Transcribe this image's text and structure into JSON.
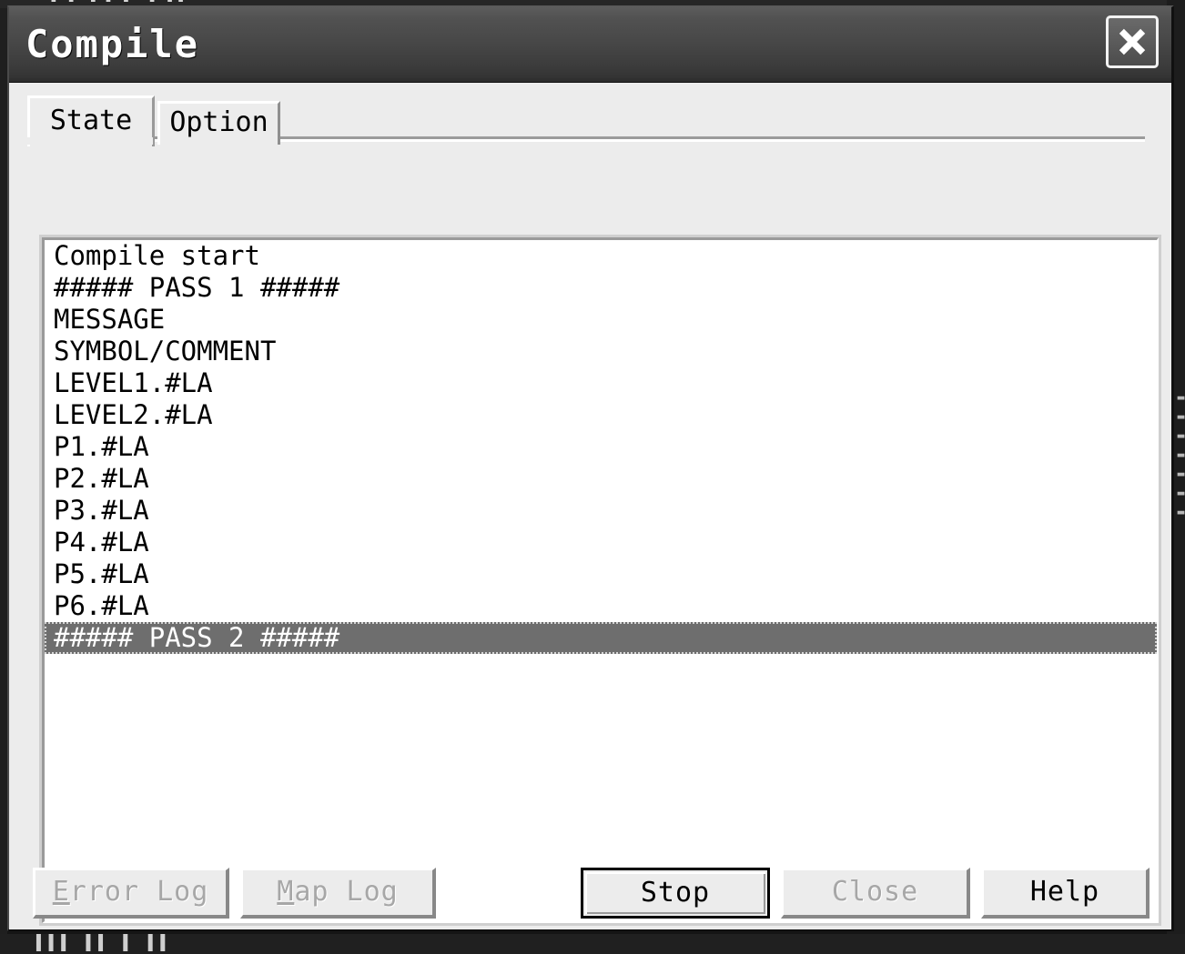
{
  "background": {
    "top_glyphs": "▐ ▌ ▌▐ ▌ ▐ ▌▌",
    "bottom_glyphs": "▌▌▌ ▌▌  ▌  ▌▌",
    "right_glyphs": "▬▬▬▬▬▬▬"
  },
  "window": {
    "title": "Compile",
    "close_icon": "close-x-icon"
  },
  "tabs": [
    {
      "label": "State",
      "active": true
    },
    {
      "label": "Option",
      "active": false
    }
  ],
  "log": {
    "lines": [
      {
        "text": "Compile start",
        "selected": false
      },
      {
        "text": "##### PASS 1 #####",
        "selected": false
      },
      {
        "text": "MESSAGE",
        "selected": false
      },
      {
        "text": "SYMBOL/COMMENT",
        "selected": false
      },
      {
        "text": "LEVEL1.#LA",
        "selected": false
      },
      {
        "text": "LEVEL2.#LA",
        "selected": false
      },
      {
        "text": "P1.#LA",
        "selected": false
      },
      {
        "text": "P2.#LA",
        "selected": false
      },
      {
        "text": "P3.#LA",
        "selected": false
      },
      {
        "text": "P4.#LA",
        "selected": false
      },
      {
        "text": "P5.#LA",
        "selected": false
      },
      {
        "text": "P6.#LA",
        "selected": false
      },
      {
        "text": "##### PASS 2 #####",
        "selected": true
      }
    ]
  },
  "buttons": {
    "error_log": {
      "accel": "E",
      "rest": "rror Log",
      "enabled": false
    },
    "map_log": {
      "accel": "M",
      "rest": "ap Log",
      "enabled": false
    },
    "stop": {
      "label": "Stop",
      "enabled": true,
      "is_default": true
    },
    "close": {
      "label": "Close",
      "enabled": false,
      "is_default": false
    },
    "help": {
      "label": "Help",
      "enabled": true,
      "is_default": false
    }
  },
  "colors": {
    "dialog_face": "#ececec",
    "titlebar_dark": "#343434",
    "selection": "#6e6e6e",
    "disabled_text": "#a7a7a7"
  }
}
